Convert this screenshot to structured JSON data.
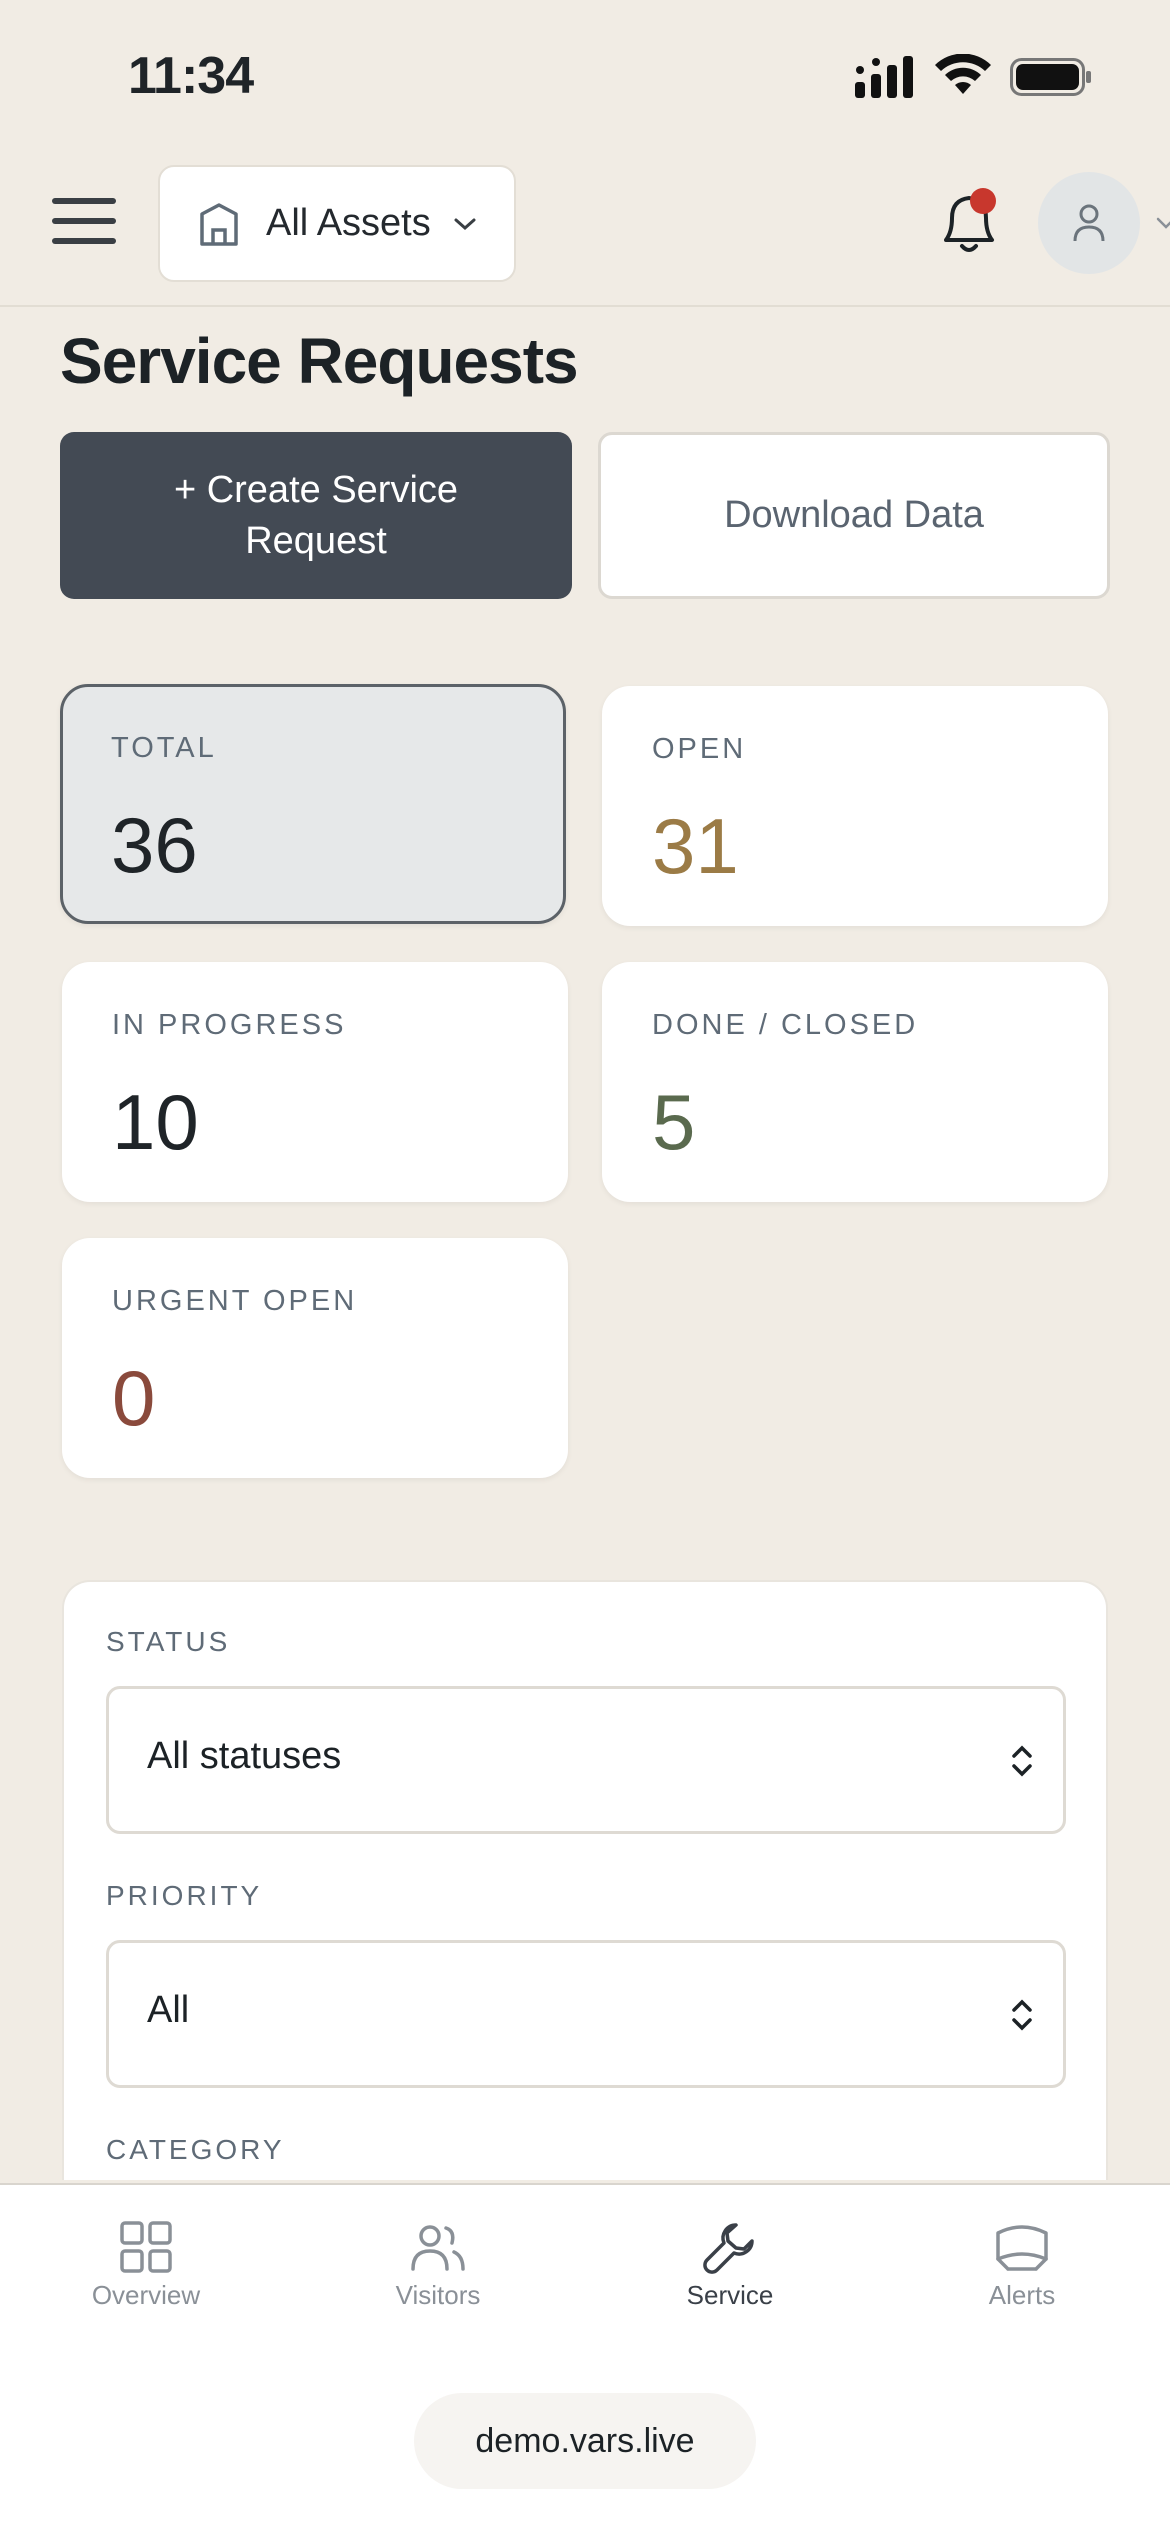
{
  "status_bar": {
    "time": "11:34"
  },
  "header": {
    "asset_selector": "All Assets",
    "has_notification": true
  },
  "page": {
    "title": "Service Requests",
    "create_button": "+ Create Service Request",
    "download_button": "Download Data"
  },
  "stats": [
    {
      "label": "TOTAL",
      "value": "36",
      "color": "#1f2428",
      "active": true
    },
    {
      "label": "OPEN",
      "value": "31",
      "color": "#9b7b46",
      "active": false
    },
    {
      "label": "IN PROGRESS",
      "value": "10",
      "color": "#1f2428",
      "active": false
    },
    {
      "label": "DONE / CLOSED",
      "value": "5",
      "color": "#5a6a4e",
      "active": false
    },
    {
      "label": "URGENT OPEN",
      "value": "0",
      "color": "#8a4a3c",
      "active": false
    }
  ],
  "filters": {
    "status_label": "STATUS",
    "status_value": "All statuses",
    "priority_label": "PRIORITY",
    "priority_value": "All",
    "category_label": "CATEGORY"
  },
  "nav": [
    {
      "label": "Overview",
      "icon": "grid-icon",
      "active": false
    },
    {
      "label": "Visitors",
      "icon": "users-icon",
      "active": false
    },
    {
      "label": "Service",
      "icon": "wrench-icon",
      "active": true
    },
    {
      "label": "Alerts",
      "icon": "alert-icon",
      "active": false
    }
  ],
  "browser": {
    "url": "demo.vars.live"
  },
  "colors": {
    "background": "#f1ece4",
    "primary_button": "#434a54",
    "notification_dot": "#c8372d"
  }
}
